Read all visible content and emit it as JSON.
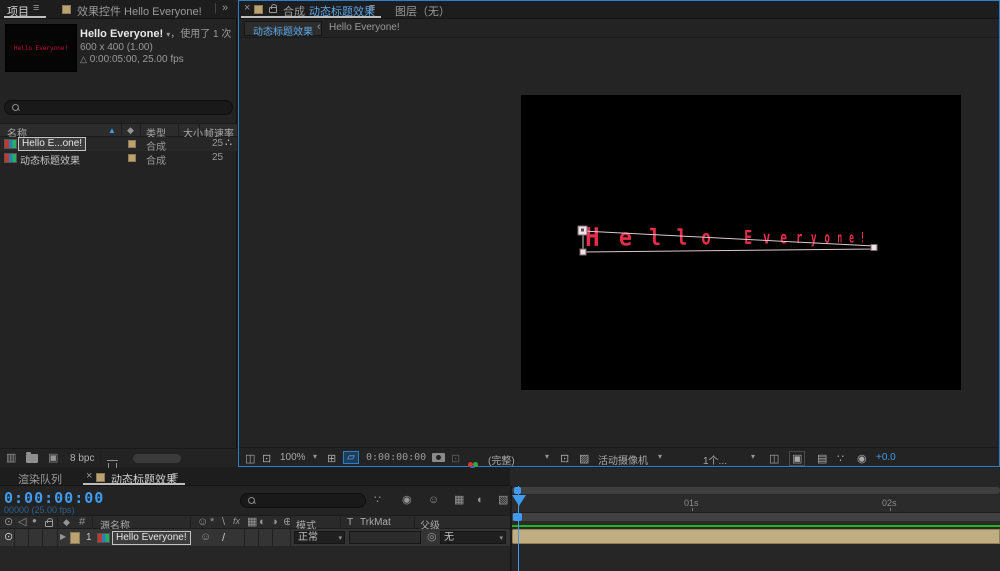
{
  "colors": {
    "accent_blue": "#3f9bf0",
    "tan_label": "#bba273",
    "red_title_text": "#e62e4c",
    "rendered_frames_green": "#23b31c",
    "layer_bar_tan": "#c0ad82",
    "focus_border_blue": "#2b7ec8"
  },
  "icons": {
    "menu": "≡",
    "overflow": "»",
    "close": "×",
    "dropdown": "▾",
    "sort_asc": "▲",
    "tag": "◆",
    "delta": "△",
    "expand_arrow": "▶",
    "back": "‹",
    "eye": "⊙",
    "audio": "◁",
    "solo": "●",
    "hash": "#",
    "shy": "☺",
    "collapse": "*",
    "quality": "\\",
    "fx": "fx",
    "frame_blend": "▦",
    "motion_blur": "◐",
    "adjustment": "◑",
    "cube_3d": "⊕",
    "always_preview": "◫",
    "main_viewer": "⊡",
    "grid": "⊞",
    "mask_visibility": "▱",
    "ghost_snapshot": "⊡",
    "roi": "⊡",
    "transparency_grid": "▨",
    "pixel_aspect": "◫",
    "fast_preview": "▣",
    "timeline_view": "▤",
    "flowchart": "∵",
    "exposure_reset": "◉",
    "footage": "▥",
    "comp_create": "▣",
    "deps": "∴",
    "pick_whip": "◎",
    "mini_flowchart": "∵",
    "live_update": "◉",
    "graph_editor": "▧",
    "slash": "/"
  },
  "project_panel": {
    "tabs": {
      "project": "项目",
      "effect_controls": "效果控件 Hello Everyone!"
    },
    "preview": {
      "name": "Hello Everyone!",
      "usage": "，使用了 1 次",
      "size": "600 x 400 (1.00)",
      "duration": "0:00:05:00, 25.00 fps",
      "thumb_text": "Hello Everyone!"
    },
    "table": {
      "col_name": "名称",
      "col_type": "类型",
      "col_size": "大小",
      "col_fps": "帧速率",
      "rows": [
        {
          "name": "Hello E...one!",
          "type": "合成",
          "fps": "25"
        },
        {
          "name": "动态标题效果",
          "type": "合成",
          "fps": "25"
        }
      ]
    },
    "footer": {
      "bpc": "8 bpc"
    }
  },
  "comp_panel": {
    "tab": {
      "prefix": "合成",
      "name": "动态标题效果"
    },
    "tab_layer": "图层（无）",
    "viewer_tabs": {
      "active": "动态标题效果",
      "other": "Hello Everyone!"
    },
    "canvas_text": "Hello Everyone!",
    "toolbar": {
      "zoom": "100%",
      "timecode": "0:00:00:00",
      "resolution": "(完整)",
      "camera": "活动摄像机",
      "views": "1个...",
      "exposure": "+0.0"
    }
  },
  "timeline": {
    "tabs": {
      "render_queue": "渲染队列",
      "comp": "动态标题效果"
    },
    "timecode": "0:00:00:00",
    "frames": "00000 (25.00 fps)",
    "columns": {
      "source_name": "源名称",
      "mode": "模式",
      "t": "T",
      "trkmat": "TrkMat",
      "parent": "父级"
    },
    "layer": {
      "index": "1",
      "name": "Hello Everyone!",
      "mode": "正常",
      "parent": "无"
    },
    "ruler": {
      "t1": "01s",
      "t2": "02s"
    }
  }
}
